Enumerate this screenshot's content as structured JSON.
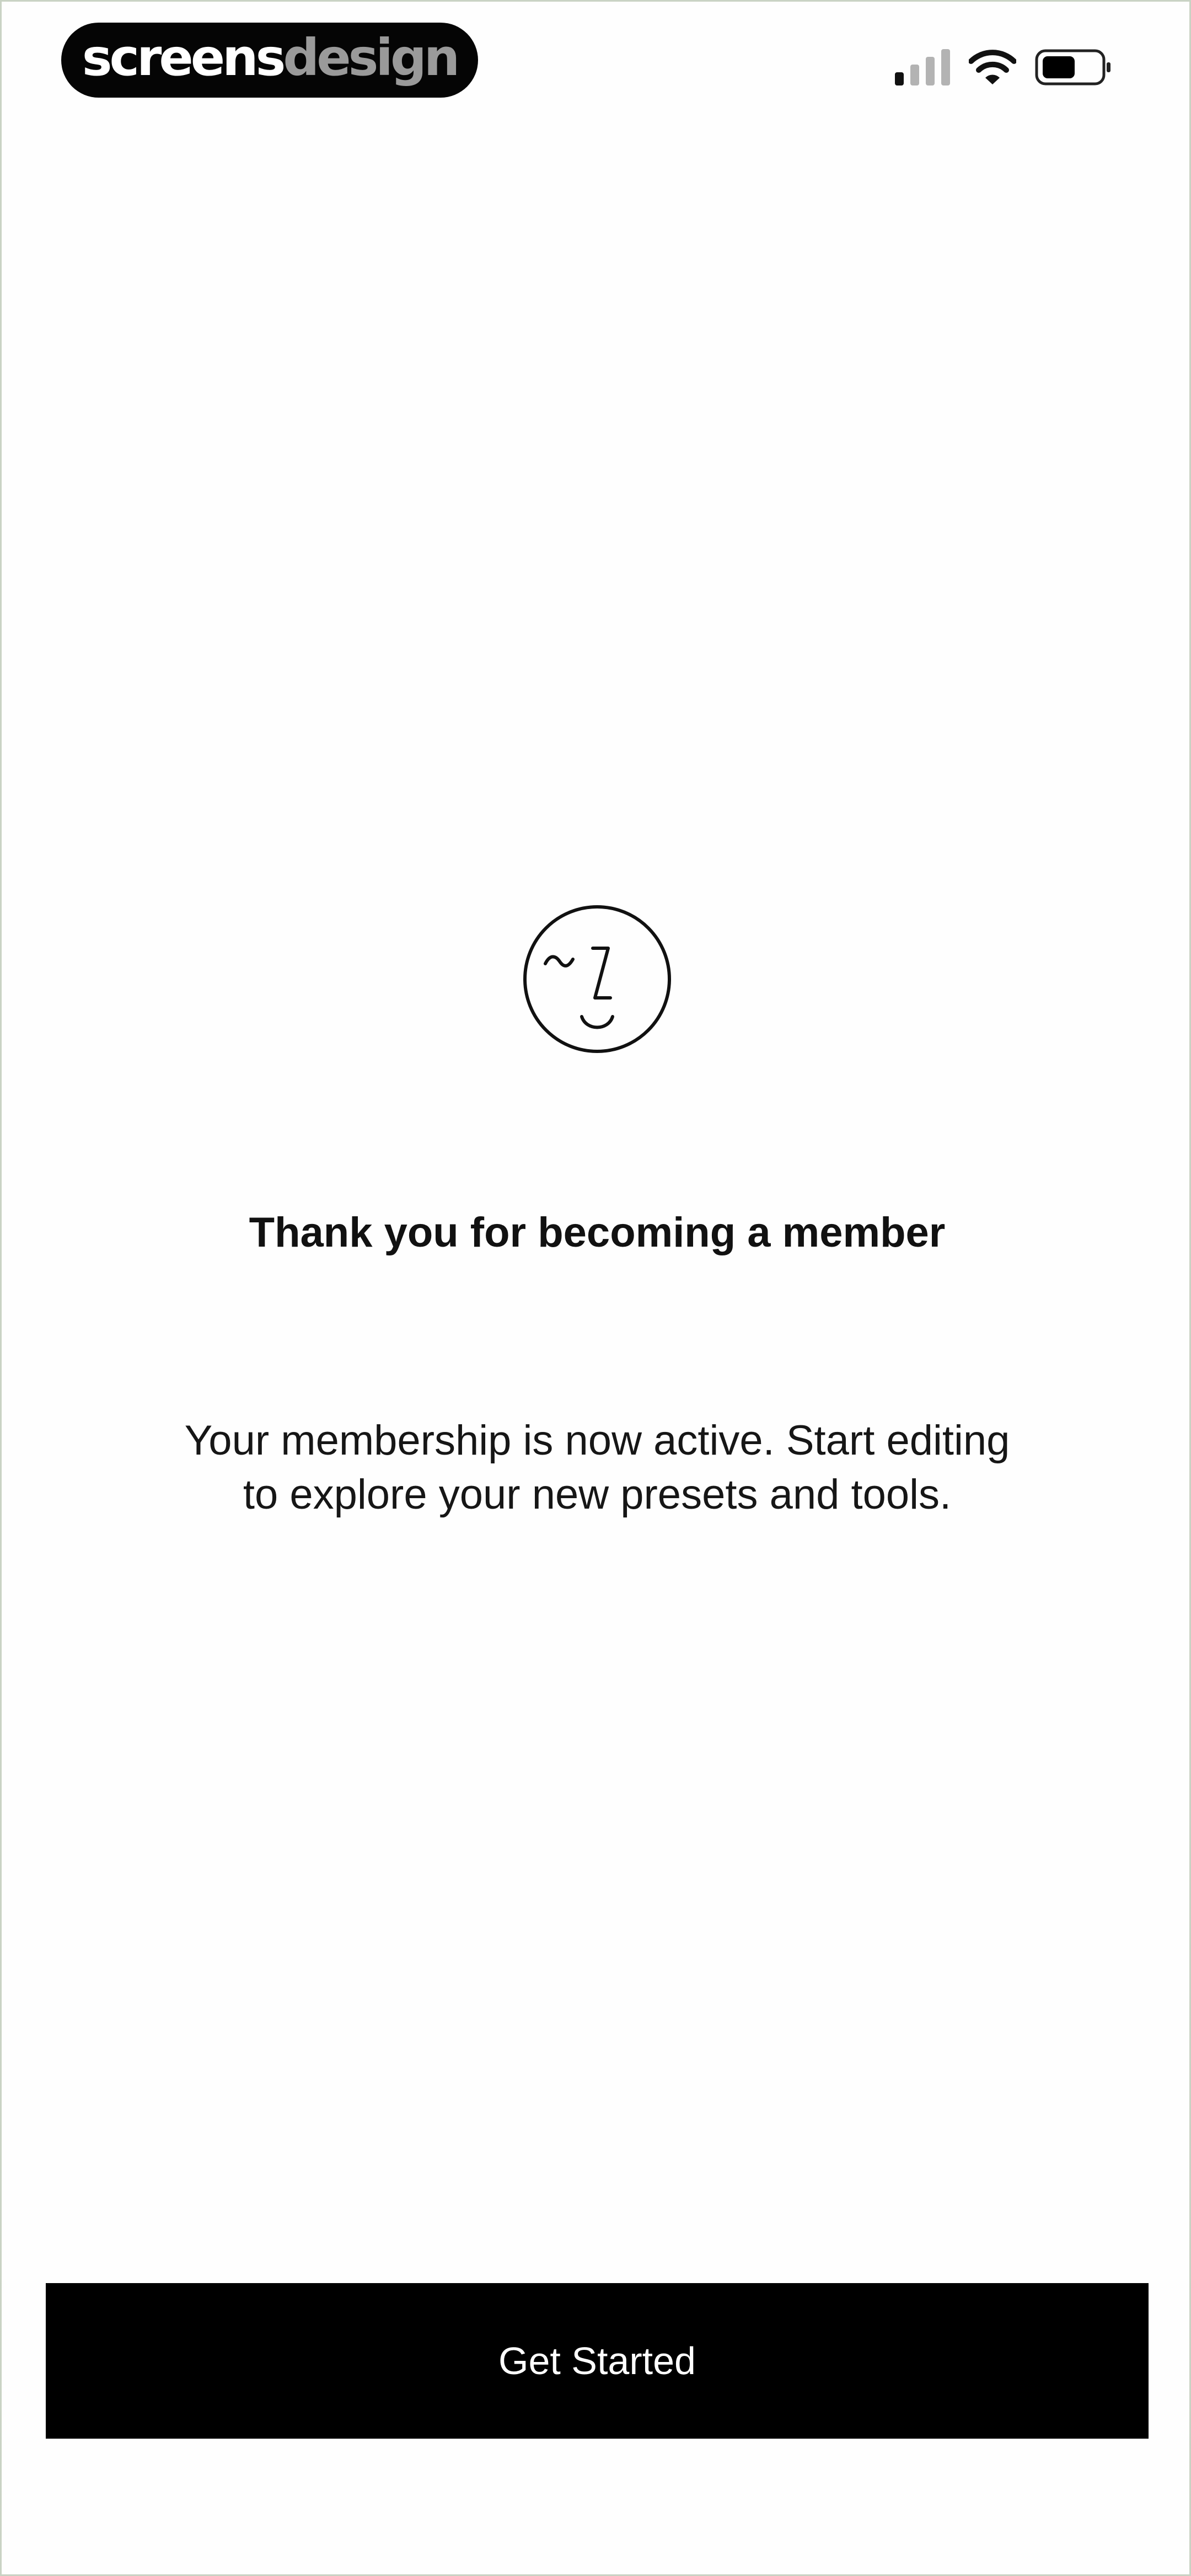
{
  "status_bar": {
    "brand_part1": "screens",
    "brand_part2": "design",
    "icons": [
      "signal-icon",
      "wifi-icon",
      "battery-icon"
    ]
  },
  "hero": {
    "icon": "face-icon",
    "title": "Thank you for becoming a member",
    "message_line1": "Your membership is now active. Start editing",
    "message_line2": "to explore your new presets and tools."
  },
  "cta": {
    "label": "Get Started"
  },
  "colors": {
    "background": "#fefefe",
    "text": "#111111",
    "button_background": "#000000",
    "button_text": "#ffffff",
    "brand_pill": "#050505",
    "brand_secondary": "#9a9a9a"
  }
}
